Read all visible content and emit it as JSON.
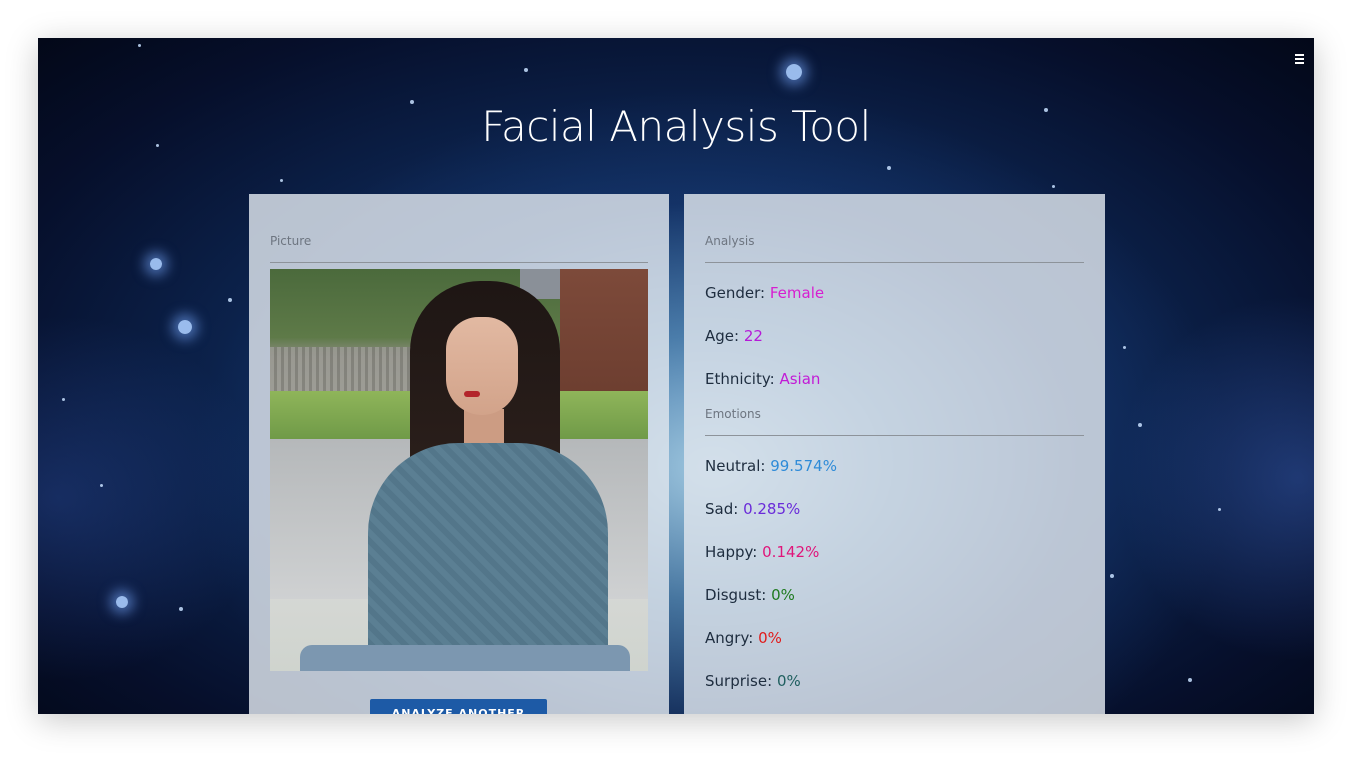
{
  "header": {
    "title": "Facial Analysis Tool",
    "menu_icon": "hamburger-icon"
  },
  "picture_panel": {
    "heading": "Picture",
    "image_alt": "Woman sitting outdoors in a blue sweater",
    "button_label": "ANALYZE ANOTHER IMAGE"
  },
  "analysis_panel": {
    "heading": "Analysis",
    "attributes": [
      {
        "label": "Gender:",
        "value": "Female",
        "color": "#d71ed0"
      },
      {
        "label": "Age:",
        "value": "22",
        "color": "#b51ad8"
      },
      {
        "label": "Ethnicity:",
        "value": "Asian",
        "color": "#c21bd6"
      }
    ],
    "emotions_heading": "Emotions",
    "emotions": [
      {
        "label": "Neutral:",
        "value": "99.574%",
        "color": "#2f8bd8"
      },
      {
        "label": "Sad:",
        "value": "0.285%",
        "color": "#6a2bd9"
      },
      {
        "label": "Happy:",
        "value": "0.142%",
        "color": "#e0157a"
      },
      {
        "label": "Disgust:",
        "value": "0%",
        "color": "#1f7a1f"
      },
      {
        "label": "Angry:",
        "value": "0%",
        "color": "#e01b1b"
      },
      {
        "label": "Surprise:",
        "value": "0%",
        "color": "#1f5f5f"
      }
    ]
  }
}
